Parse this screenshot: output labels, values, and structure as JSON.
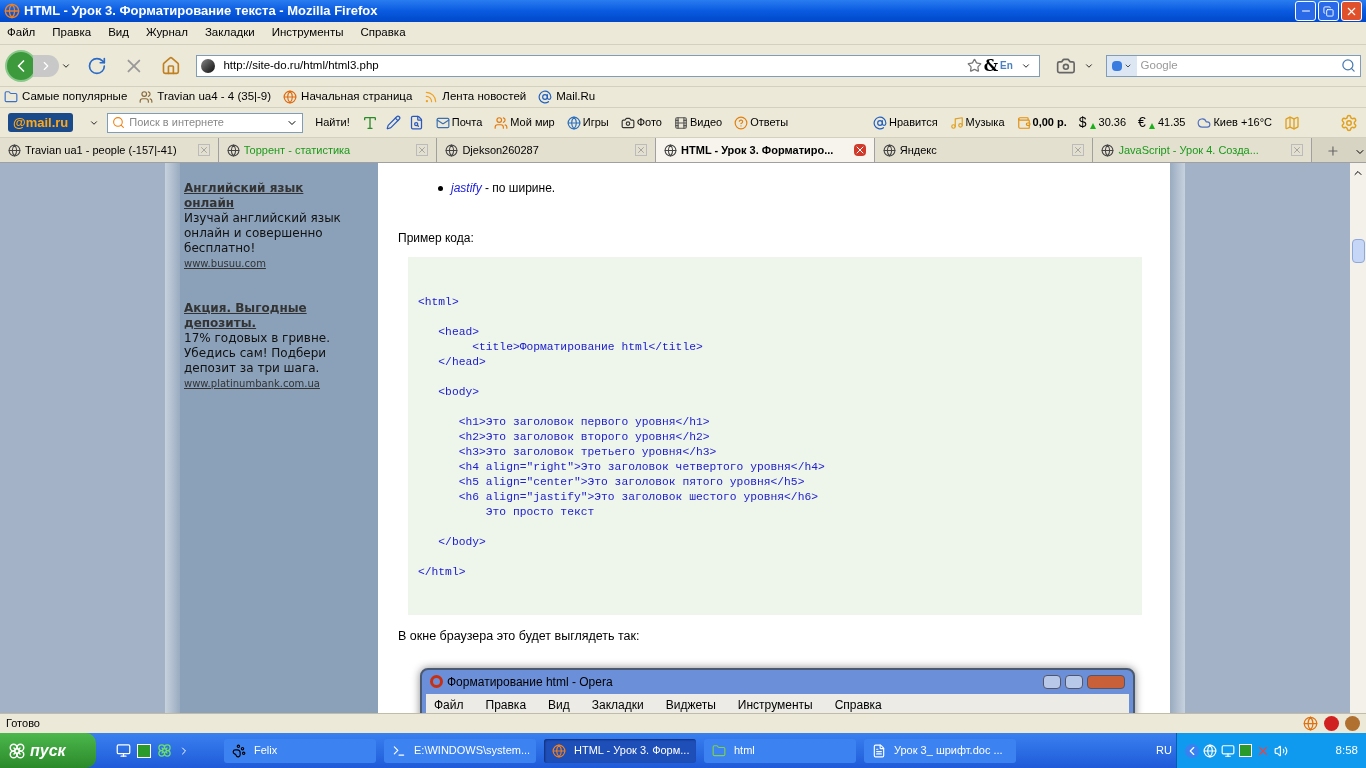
{
  "window": {
    "title": "HTML - Урок 3. Форматирование текста - Mozilla Firefox"
  },
  "menu": [
    "Файл",
    "Правка",
    "Вид",
    "Журнал",
    "Закладки",
    "Инструменты",
    "Справка"
  ],
  "nav": {
    "url": "http://site-do.ru/html/html3.php",
    "lang_badge": "En",
    "ampersand": "&",
    "search_placeholder": "Google"
  },
  "bookmarks": [
    {
      "label": "Самые популярные",
      "kind": "folder"
    },
    {
      "label": "Travian ua4 - 4 (35|-9)",
      "kind": "game"
    },
    {
      "label": "Начальная страница",
      "kind": "browser"
    },
    {
      "label": "Лента новостей",
      "kind": "feed"
    },
    {
      "label": "Mail.Ru",
      "kind": "at"
    }
  ],
  "mailbar": {
    "logo": "@mail.ru",
    "search_placeholder": "Поиск в интернете",
    "find_button": "Найти!",
    "links": [
      {
        "label": "Почта",
        "kind": "mail"
      },
      {
        "label": "Мой мир",
        "kind": "people"
      },
      {
        "label": "Игры",
        "kind": "globe"
      },
      {
        "label": "Фото",
        "kind": "camera"
      },
      {
        "label": "Видео",
        "kind": "film"
      },
      {
        "label": "Ответы",
        "kind": "question"
      }
    ],
    "widgets": [
      {
        "label": "Нравится",
        "kind": "at"
      },
      {
        "label": "Музыка",
        "kind": "music"
      },
      {
        "label": "0,00 р.",
        "kind": "wallet"
      },
      {
        "symbol": "$",
        "label": "30.36",
        "kind": "rate"
      },
      {
        "symbol": "€",
        "label": "41.35",
        "kind": "rate"
      },
      {
        "label": "Киев +16°C",
        "kind": "weather"
      }
    ]
  },
  "tabs": [
    {
      "label": "Travian ua1 - people (-157|-41)",
      "selected": false,
      "color": "#000000"
    },
    {
      "label": "Торрент - статистика",
      "selected": false,
      "color": "#1a9a1a"
    },
    {
      "label": "Djekson260287",
      "selected": false,
      "color": "#000000"
    },
    {
      "label": "HTML - Урок 3. Форматиро...",
      "selected": true,
      "color": "#000000"
    },
    {
      "label": "Яндекс",
      "selected": false,
      "color": "#000000"
    },
    {
      "label": "JavaScript - Урок 4. Созда...",
      "selected": false,
      "color": "#1a9a1a"
    }
  ],
  "sidebar": {
    "ads": [
      {
        "title": "Английский язык онлайн",
        "text": "Изучай английский язык онлайн и совершенно бесплатно!",
        "link": "www.busuu.com"
      },
      {
        "title": "Акция. Выгодные депозиты.",
        "text": "17% годовых в гривне. Убедись сам! Подбери депозит за три шага.",
        "link": "www.platinumbank.com.ua"
      }
    ]
  },
  "article": {
    "bullet": {
      "term": "jastify",
      "rest": " - по ширине."
    },
    "example_label": "Пример кода:",
    "code_groups": [
      [
        "<html>"
      ],
      [
        "   <head>",
        "        <title>Форматирование html</title>",
        "   </head>"
      ],
      [
        "   <body>"
      ],
      [
        "      <h1>Это заголовок первого уровня</h1>",
        "      <h2>Это заголовок второго уровня</h2>",
        "      <h3>Это заголовок третьего уровня</h3>",
        "      <h4 align=\"right\">Это заголовок четвертого уровня</h4>",
        "      <h5 align=\"center\">Это заголовок пятого уровня</h5>",
        "      <h6 align=\"jastify\">Это заголовок шестого уровня</h6>",
        "          Это просто текст"
      ],
      [
        "   </body>"
      ],
      [
        "</html>"
      ]
    ],
    "result_label": "В окне браузера это будет выглядеть так:",
    "opera": {
      "title": "Форматирование html - Opera",
      "menu": [
        "Файл",
        "Правка",
        "Вид",
        "Закладки",
        "Виджеты",
        "Инструменты",
        "Справка"
      ]
    }
  },
  "status_bar": {
    "text": "Готово"
  },
  "taskbar": {
    "start": "пуск",
    "tasks": [
      {
        "label": "Felix",
        "selected": false,
        "kind": "paw"
      },
      {
        "label": "E:\\WINDOWS\\system...",
        "selected": false,
        "kind": "console"
      },
      {
        "label": "HTML - Урок 3. Форм...",
        "selected": true,
        "kind": "browser"
      },
      {
        "label": "html",
        "selected": false,
        "kind": "folder"
      },
      {
        "label": "Урок 3_ шрифт.doc ...",
        "selected": false,
        "kind": "doc"
      }
    ],
    "language": "RU",
    "clock": "8:58"
  }
}
